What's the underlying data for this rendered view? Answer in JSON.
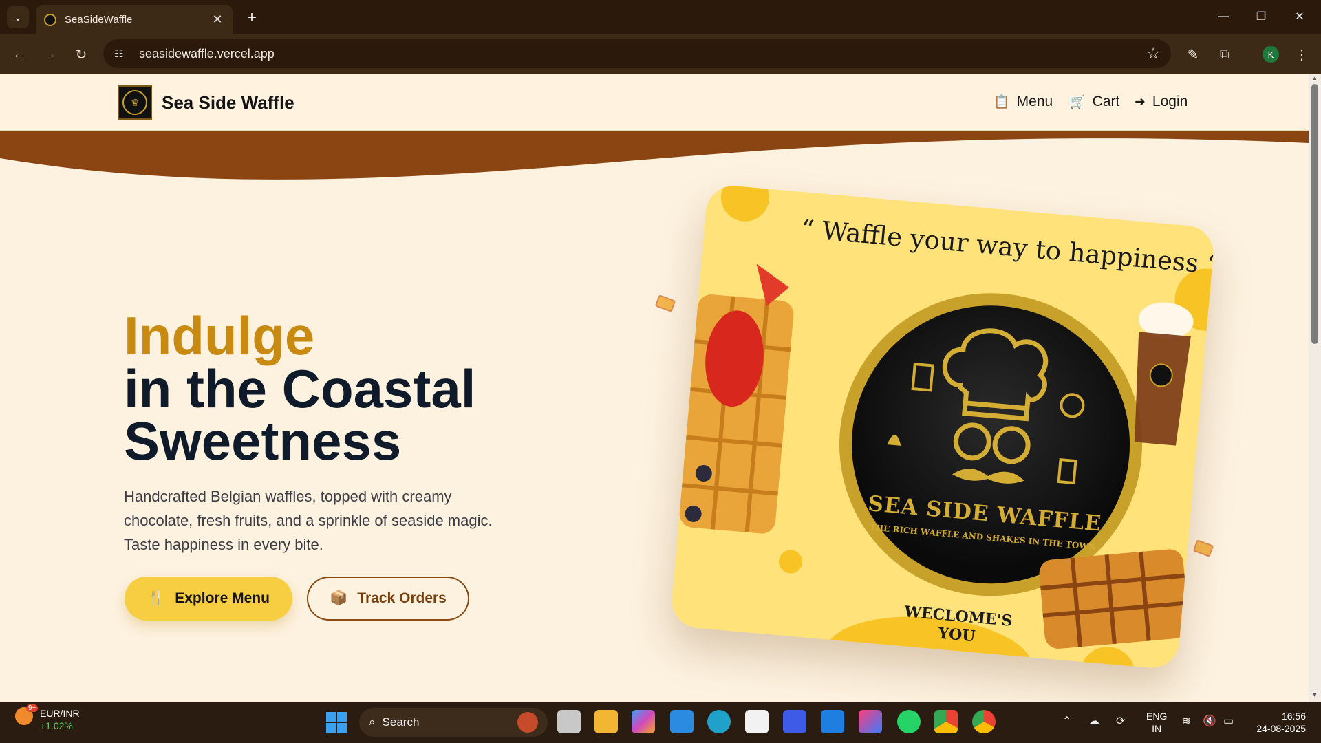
{
  "browser": {
    "tab_title": "SeaSideWaffle",
    "tab_close": "✕",
    "new_tab": "+",
    "url": "seasidewaffle.vercel.app",
    "window_controls": {
      "minimize": "—",
      "restore": "❐",
      "close": "✕"
    }
  },
  "site": {
    "brand": "Sea Side Waffle",
    "nav": [
      {
        "label": "Menu",
        "icon": "clipboard-icon"
      },
      {
        "label": "Cart",
        "icon": "cart-icon"
      },
      {
        "label": "Login",
        "icon": "login-icon"
      }
    ],
    "hero": {
      "highlight": "Indulge",
      "line2": "in the Coastal",
      "line3": "Sweetness",
      "description": "Handcrafted Belgian waffles, topped with creamy chocolate, fresh fruits, and a sprinkle of seaside magic. Taste happiness in every bite.",
      "primary_cta": "Explore Menu",
      "secondary_cta": "Track Orders"
    },
    "card": {
      "quote": "“ Waffle your way to happiness “",
      "emblem_title": "SEA SIDE WAFFLE",
      "emblem_subtitle": "THE RICH WAFFLE AND SHAKES IN THE TOWN",
      "welcome_line1": "WECLOME'S",
      "welcome_line2": "YOU"
    },
    "colors": {
      "accent": "#f7ce42",
      "brown": "#8a4a12",
      "gold": "#c98a12",
      "dark": "#0f1b2a",
      "background": "#fdf2e0"
    }
  },
  "taskbar": {
    "weather_badge": "9+",
    "ticker": "EUR/INR",
    "ticker_change": "+1.02%",
    "search_placeholder": "Search",
    "lang_1": "ENG",
    "lang_2": "IN",
    "time": "16:56",
    "date": "24-08-2025"
  }
}
